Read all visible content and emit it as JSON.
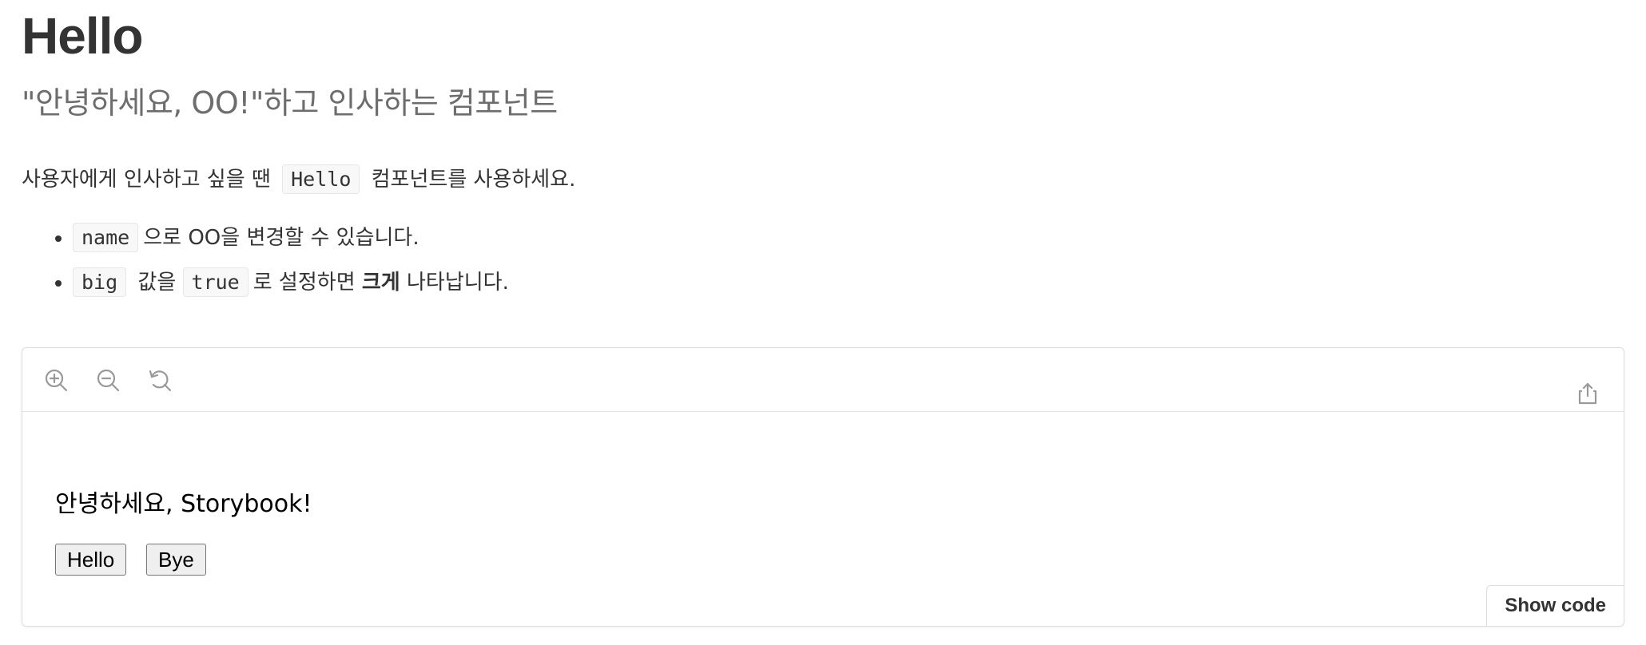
{
  "title": "Hello",
  "subtitle": "\"안녕하세요, OO!\"하고 인사하는 컴포넌트",
  "intro": {
    "before": "사용자에게 인사하고 싶을 땐",
    "code": "Hello",
    "after": "컴포넌트를 사용하세요."
  },
  "bullets": [
    {
      "code": "name",
      "text": "으로 OO을 변경할 수 있습니다."
    },
    {
      "code1": "big",
      "mid": "값을",
      "code2": "true",
      "text1": "로 설정하면",
      "bold": "크게",
      "text2": "나타납니다."
    }
  ],
  "preview": {
    "greeting": "안녕하세요, Storybook!",
    "buttons": {
      "hello": "Hello",
      "bye": "Bye"
    },
    "show_code": "Show code",
    "icons": [
      "zoom-in-icon",
      "zoom-out-icon",
      "reset-zoom-icon",
      "share-icon"
    ]
  },
  "colors": {
    "text": "#333333",
    "muted": "#6d6d6d",
    "border": "#dcdcdc"
  }
}
